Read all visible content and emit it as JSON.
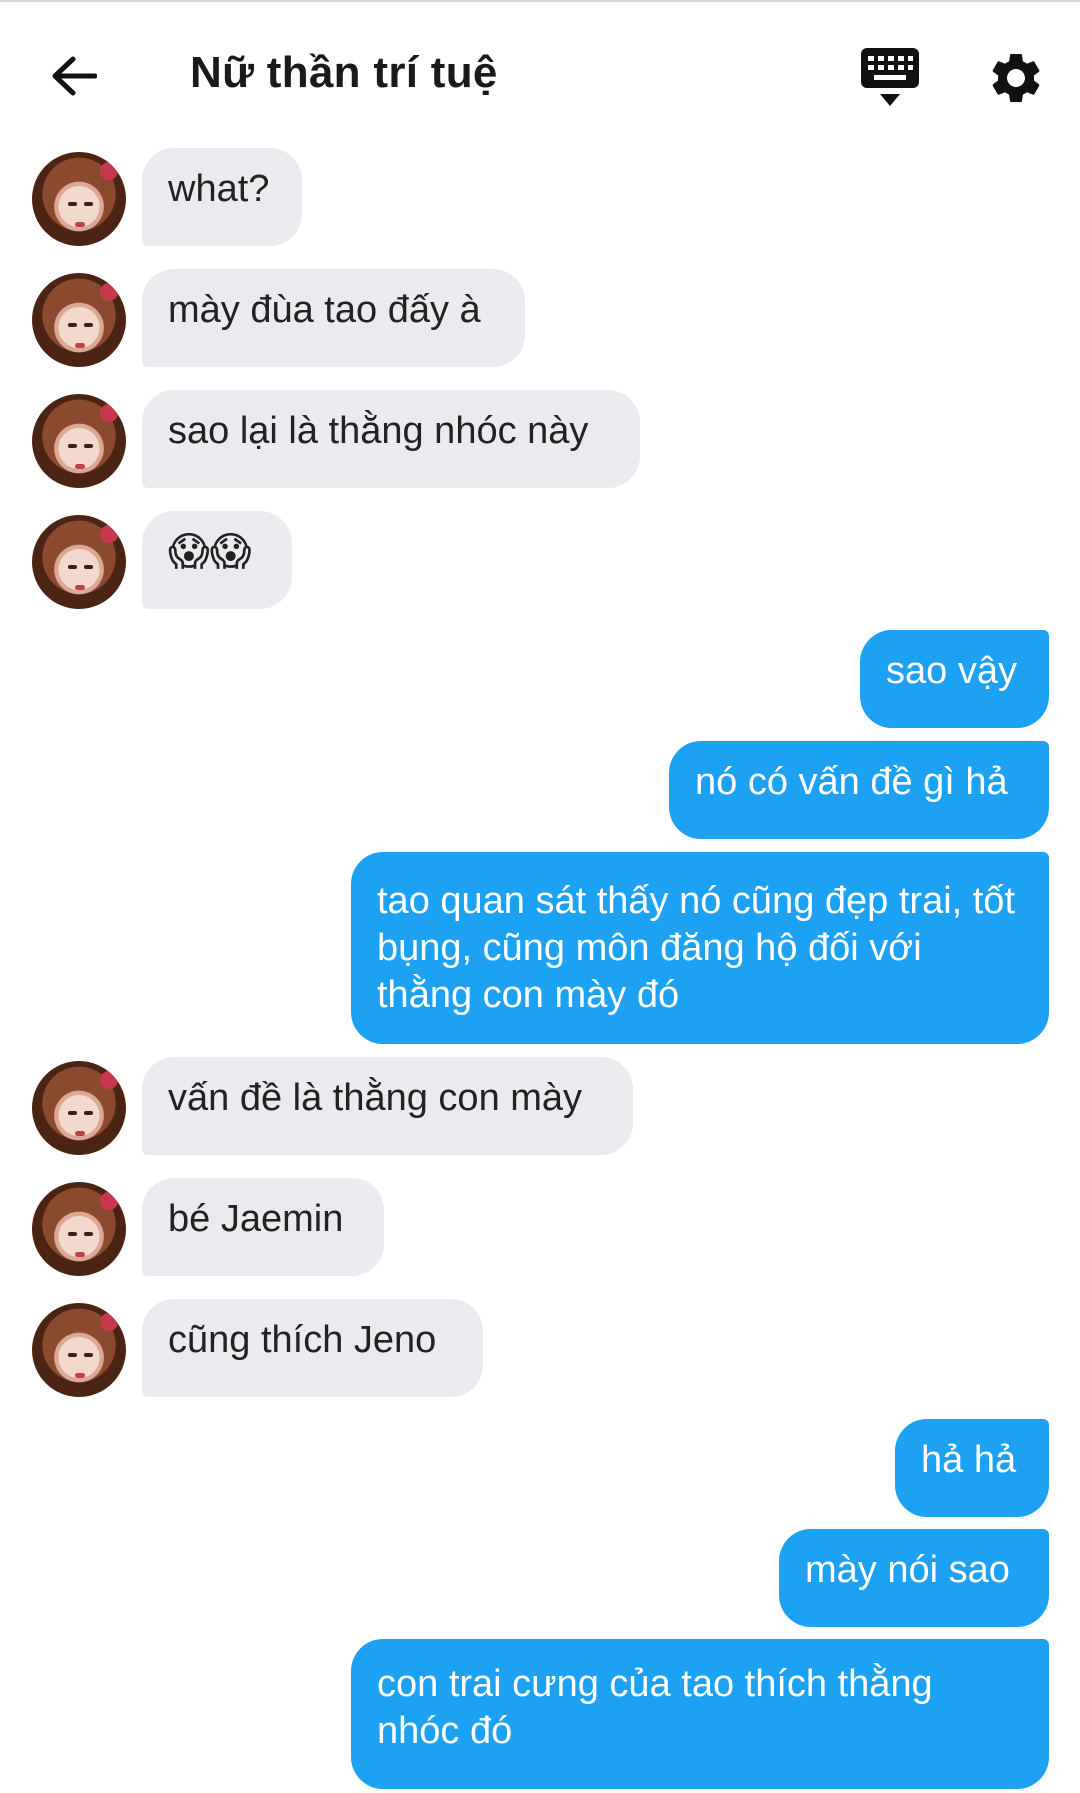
{
  "header": {
    "title": "Nữ thần trí tuệ",
    "back_icon": "arrow-left-icon",
    "keyboard_icon": "keyboard-icon",
    "settings_icon": "gear-icon"
  },
  "colors": {
    "incoming_bubble": "#e9ebee",
    "outgoing_bubble": "#1da1f2"
  },
  "messages": [
    {
      "from": "them",
      "text": "what?"
    },
    {
      "from": "them",
      "text": "mày đùa tao đấy à"
    },
    {
      "from": "them",
      "text": "sao lại là thằng nhóc này"
    },
    {
      "from": "them",
      "text": "😱😱"
    },
    {
      "from": "me",
      "text": "sao vậy"
    },
    {
      "from": "me",
      "text": "nó có vấn đề gì hả"
    },
    {
      "from": "me",
      "text": "tao quan sát thấy nó cũng đẹp trai, tốt bụng, cũng môn đăng hộ đối với thằng con mày đó"
    },
    {
      "from": "them",
      "text": "vấn đề là thằng con mày"
    },
    {
      "from": "them",
      "text": "bé Jaemin"
    },
    {
      "from": "them",
      "text": "cũng thích Jeno"
    },
    {
      "from": "me",
      "text": "hả hả"
    },
    {
      "from": "me",
      "text": "mày nói sao"
    },
    {
      "from": "me",
      "text": "con trai cưng của tao thích thằng nhóc đó"
    }
  ]
}
